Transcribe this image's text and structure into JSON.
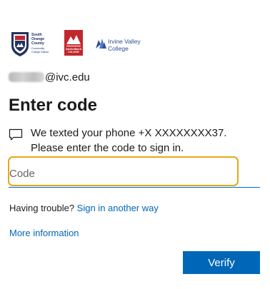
{
  "logos": {
    "socc": {
      "name_lines": [
        "South",
        "Orange",
        "County"
      ],
      "sub_lines": [
        "Community",
        "College District"
      ]
    },
    "saddleback": {
      "lines": [
        "SADDLEBACK",
        "COLLEGE"
      ],
      "color": "#c1272d"
    },
    "ivc": {
      "line1": "Irvine Valley",
      "line2": "College",
      "color": "#2f4f95"
    }
  },
  "account": {
    "domain": "@ivc.edu"
  },
  "title": "Enter code",
  "message": {
    "icon": "chat-bubble-icon",
    "text": "We texted your phone +X XXXXXXXX37. Please enter the code to sign in."
  },
  "code_input": {
    "placeholder": "Code",
    "value": ""
  },
  "trouble": {
    "label": "Having trouble?",
    "link": "Sign in another way"
  },
  "more_info": "More information",
  "verify_button": "Verify",
  "colors": {
    "accent": "#0067b8",
    "focus_ring": "#e6a817",
    "text": "#1b1b1b"
  }
}
